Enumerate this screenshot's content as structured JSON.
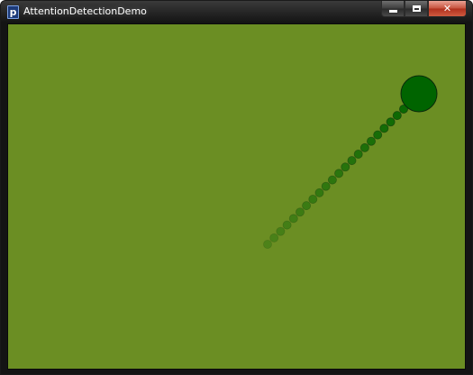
{
  "window": {
    "title": "AttentionDetectionDemo",
    "app_icon_glyph": "p",
    "close_glyph": "✕"
  },
  "icons": {
    "app": "processing-app-icon",
    "minimize": "minimize-icon",
    "maximize": "maximize-icon",
    "close": "close-icon"
  },
  "colors": {
    "canvas_background": "#6b8e23",
    "target_fill": "#006400",
    "trail_fill": "#006400"
  }
}
